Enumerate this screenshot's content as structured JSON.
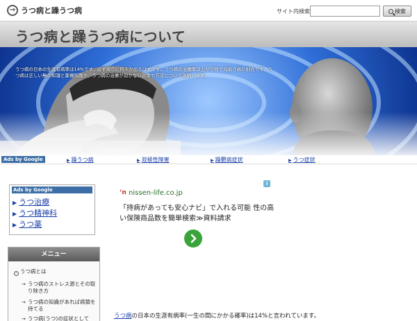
{
  "site": {
    "name": "うつ病と躁うつ病",
    "search_label": "サイト内検索:",
    "search_value": "",
    "search_button": "検索"
  },
  "header": {
    "title": "うつ病と躁うつ病について"
  },
  "banner": {
    "intro": "うつ病の日本の生涯有病率は14%です。必ず周りに何人か出るはずです。うつ病の治療率は上がり性で元気さ高い割合です。うつ病は正しい無の知識と薬機知識や、うつ病の治療が効かない対策や方法について説明します。"
  },
  "navbar": {
    "ads_label": "Ads by Google",
    "links": [
      "躁うつ病",
      "双極性障害",
      "躁鬱病症状",
      "うつ症状"
    ]
  },
  "side_ad": {
    "ads_label": "Ads by Google",
    "links": [
      "うつ治療",
      "うつ精神科",
      "うつ薬"
    ]
  },
  "menu": {
    "title": "メニュー",
    "item": "うつ病とは",
    "subitems": [
      "うつ病のストレス源とその取り除き方",
      "うつ病の知識があれば病鎖を持てる",
      "うつ病(うつ)の症状として"
    ]
  },
  "ad": {
    "domain": "nissen-life.co.jp",
    "text": "「持病があっても安心ナビ」で入れる可能 性の高い保険商品数を簡単検索≫資料請求"
  },
  "bottom": {
    "keyword": "うつ病",
    "text": "の日本の生涯有病率(一生の間にかかる確率)は14%と言われています。"
  },
  "colors": {
    "link": "#1a3ea8",
    "ads_tag": "#3d6fa6",
    "go_button": "#3aa43a",
    "ad_domain": "#2b6e2b"
  },
  "icons": {
    "logo": "arrow-circle-icon",
    "search": "magnifier-icon",
    "go": "chevron-right-icon",
    "ad_info": "info-icon"
  }
}
